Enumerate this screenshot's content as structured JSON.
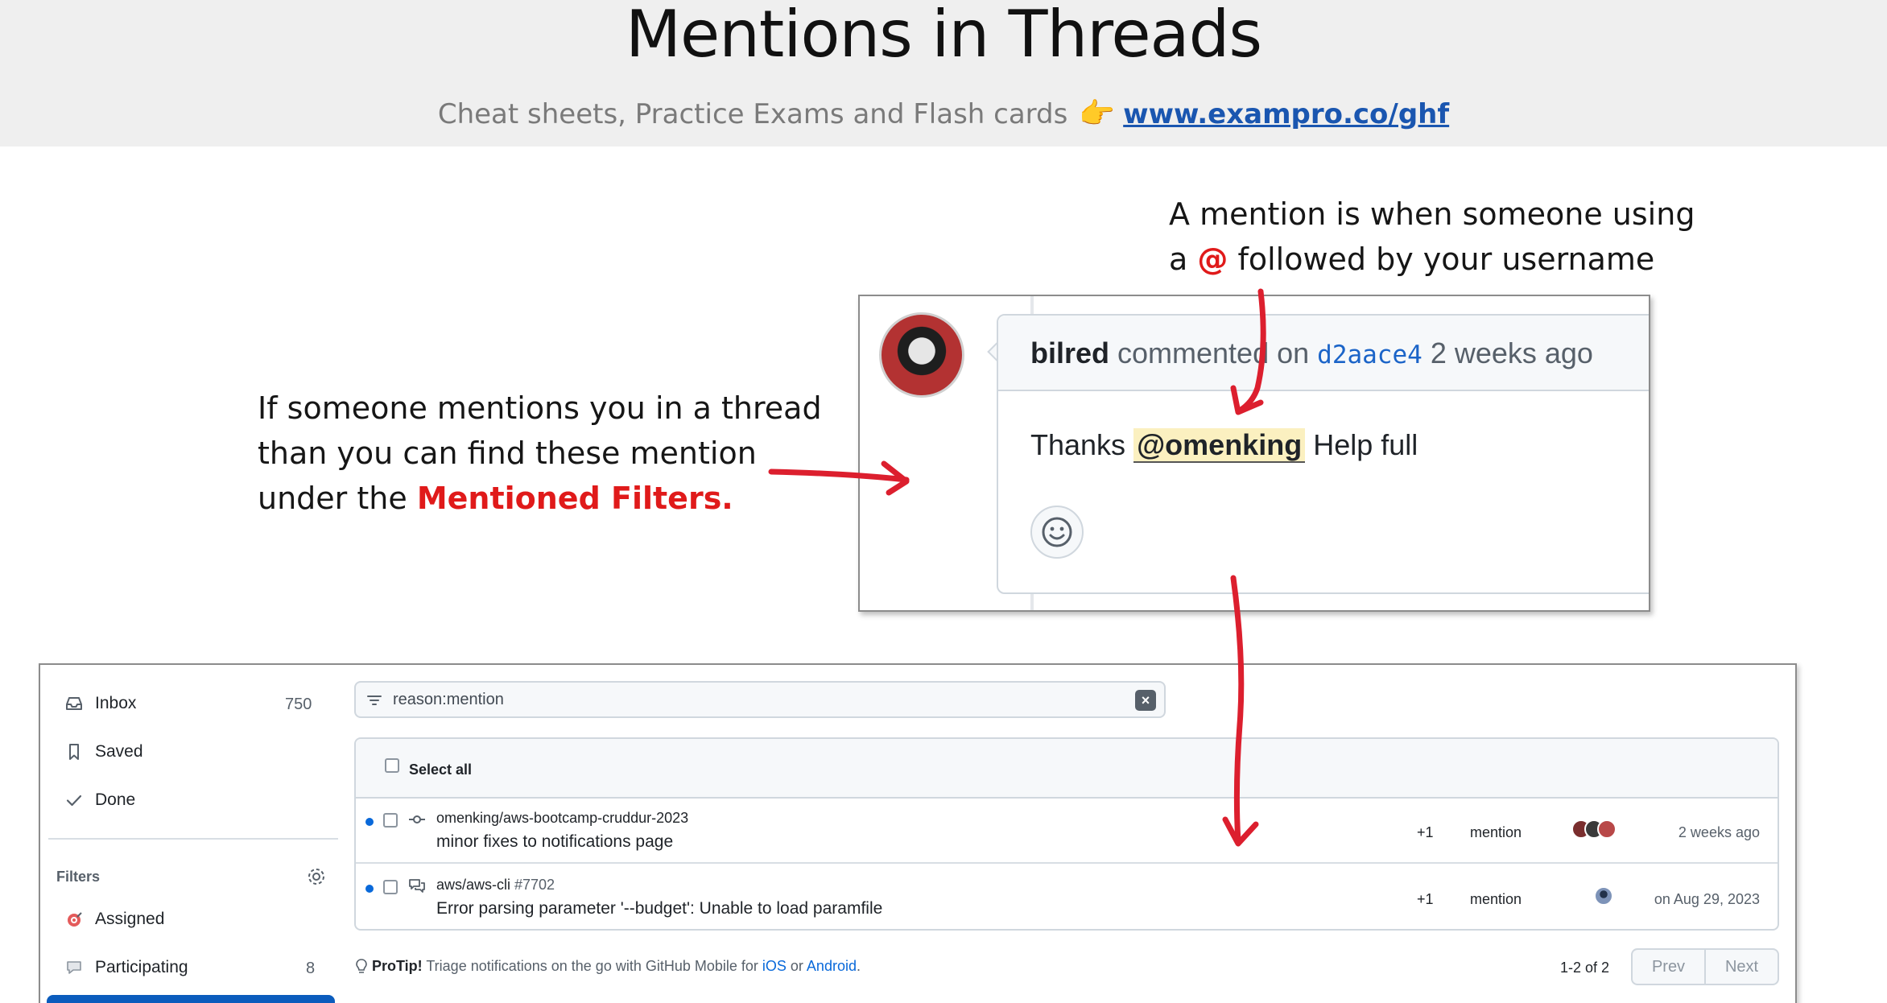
{
  "slide": {
    "title": "Mentions in Threads",
    "subtitle_text": "Cheat sheets, Practice Exams and Flash cards",
    "subtitle_link": "www.exampro.co/ghf",
    "note_right_line1": "A mention is when someone using",
    "note_right_line2_a": "a ",
    "note_right_at": "@",
    "note_right_line2_b": " followed by your username",
    "note_left_line1": "If someone mentions you in a thread",
    "note_left_line2": "than you can find these mention",
    "note_left_line3_a": "under the ",
    "note_left_highlight": "Mentioned Filters."
  },
  "comment": {
    "author": "bilred",
    "action": " commented on ",
    "commit": "d2aace4",
    "time": " 2 weeks ago",
    "body_before": "Thanks ",
    "mention": "@omenking",
    "body_after": " Help full"
  },
  "sidebar": {
    "inbox_label": "Inbox",
    "inbox_count": "750",
    "saved_label": "Saved",
    "done_label": "Done",
    "filters_label": "Filters",
    "assigned_label": "Assigned",
    "participating_label": "Participating",
    "participating_count": "8"
  },
  "filter": {
    "query": "reason:mention"
  },
  "list": {
    "select_all": "Select all",
    "rows": [
      {
        "repo": "omenking/aws-bootcamp-cruddur-2023",
        "number": "",
        "title": "minor fixes to notifications page",
        "plus": "+1",
        "reason": "mention",
        "when": "2 weeks ago"
      },
      {
        "repo": "aws/aws-cli",
        "number": " #7702",
        "title": "Error parsing parameter '--budget': Unable to load paramfile",
        "plus": "+1",
        "reason": "mention",
        "when": "on Aug 29, 2023"
      }
    ]
  },
  "footer": {
    "protip_label": "ProTip!",
    "protip_text": " Triage notifications on the go with GitHub Mobile for ",
    "ios": "iOS",
    "or": " or ",
    "android": "Android",
    "period": ".",
    "page_count": "1-2 of 2",
    "prev": "Prev",
    "next": "Next"
  },
  "colors": {
    "accent_red": "#e01a1a",
    "link_blue": "#1a56b0",
    "unread_dot": "#0969da",
    "mention_highlight": "#fbf0c0"
  },
  "icons": [
    "pointing-hand-icon",
    "inbox-icon",
    "bookmark-icon",
    "check-icon",
    "gear-icon",
    "target-icon",
    "speech-bubble-icon",
    "filter-icon",
    "clear-icon",
    "commit-icon",
    "discussion-icon",
    "lightbulb-icon",
    "smiley-icon"
  ]
}
